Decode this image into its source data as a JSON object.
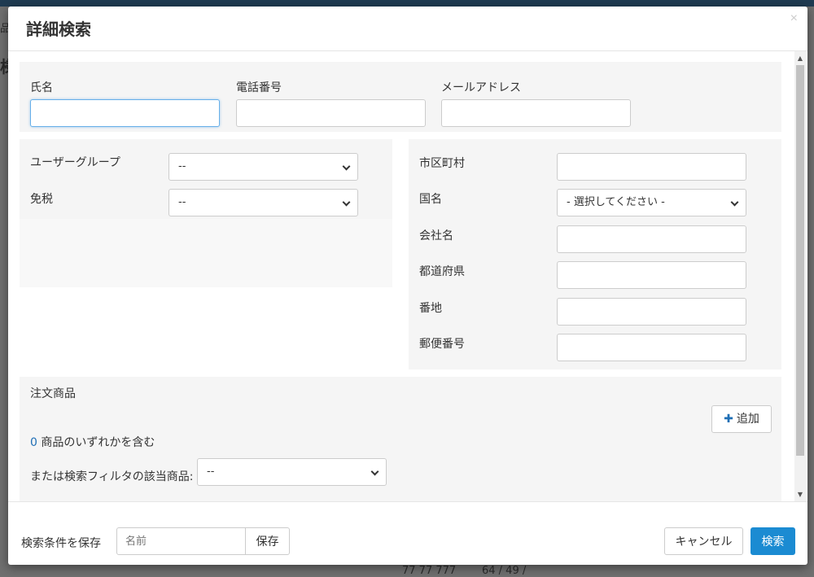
{
  "modal": {
    "title": "詳細検索",
    "close": "×"
  },
  "top": {
    "name_label": "氏名",
    "name_value": "",
    "phone_label": "電話番号",
    "phone_value": "",
    "email_label": "メールアドレス",
    "email_value": ""
  },
  "left": {
    "user_group_label": "ユーザーグループ",
    "user_group_value": "--",
    "tax_exempt_label": "免税",
    "tax_exempt_value": "--"
  },
  "right": {
    "city_label": "市区町村",
    "country_label": "国名",
    "country_value": "- 選択してください -",
    "company_label": "会社名",
    "prefecture_label": "都道府県",
    "address_label": "番地",
    "zip_label": "郵便番号"
  },
  "products": {
    "section_label": "注文商品",
    "add_button": "追加",
    "count": "0",
    "count_text": "商品のいずれかを含む",
    "filter_label": "または検索フィルタの該当商品:",
    "filter_value": "--"
  },
  "footer": {
    "save_criteria_label": "検索条件を保存",
    "name_placeholder": "名前",
    "save_button": "保存",
    "cancel_button": "キャンセル",
    "search_button": "検索"
  },
  "background": {
    "frag1": "品",
    "frag2": "様",
    "frag3": "77 77 777",
    "frag4": "64 / 49 /"
  },
  "colors": {
    "primary": "#1b8bd2",
    "focus_border": "#66afe9",
    "panel": "#f5f5f5"
  }
}
